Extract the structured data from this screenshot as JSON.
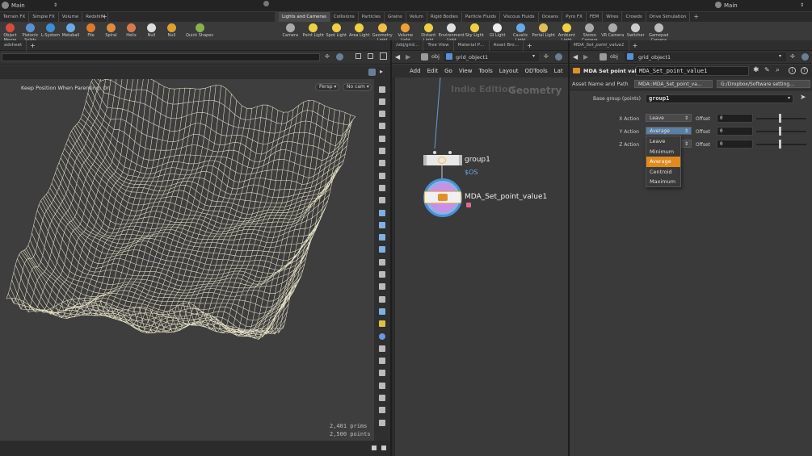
{
  "left_desktop": {
    "name": "Main"
  },
  "right_desktop": {
    "name": "Main"
  },
  "left_shelf_tabs": [
    "Terrain FX",
    "Simple FX",
    "Volume",
    "Redshift"
  ],
  "left_tools": [
    {
      "label": "Object Merge",
      "color": "#d94a3a"
    },
    {
      "label": "Platonic Solids",
      "color": "#5a8fd6"
    },
    {
      "label": "L-System",
      "color": "#3a8fd9"
    },
    {
      "label": "Metaball",
      "color": "#6aa9e9"
    },
    {
      "label": "File",
      "color": "#e07a2a"
    },
    {
      "label": "Spiral",
      "color": "#e08a3a"
    },
    {
      "label": "Helix",
      "color": "#d97a4a"
    },
    {
      "label": "Null",
      "color": "#dddddd"
    },
    {
      "label": "Null",
      "color": "#e0a030"
    },
    {
      "label": "Quick Shapes",
      "color": "#8ab04a"
    }
  ],
  "right_shelf_tabs": [
    "Lights and Cameras",
    "Collisions",
    "Particles",
    "Grains",
    "Velum",
    "Rigid Bodies",
    "Particle Fluids",
    "Viscous Fluids",
    "Oceans",
    "Pyro FX",
    "FEM",
    "Wires",
    "Crowds",
    "Drive Simulation"
  ],
  "right_tools": [
    {
      "label": "Camera",
      "color": "#aaaaaa"
    },
    {
      "label": "Point Light",
      "color": "#f0d040"
    },
    {
      "label": "Spot Light",
      "color": "#f0d040"
    },
    {
      "label": "Area Light",
      "color": "#f0d040"
    },
    {
      "label": "Geometry Light",
      "color": "#f0c040"
    },
    {
      "label": "Volume Light",
      "color": "#f0a030"
    },
    {
      "label": "Distant Light",
      "color": "#f0d040"
    },
    {
      "label": "Environment Light",
      "color": "#e0e0e0"
    },
    {
      "label": "Sky Light",
      "color": "#f0d040"
    },
    {
      "label": "GI Light",
      "color": "#eeeeee"
    },
    {
      "label": "Caustic Light",
      "color": "#6aa9e9"
    },
    {
      "label": "Portal Light",
      "color": "#e0c050"
    },
    {
      "label": "Ambient Light",
      "color": "#f0d040"
    },
    {
      "label": "Stereo Camera",
      "color": "#aaaaaa"
    },
    {
      "label": "VR Camera",
      "color": "#aaaaaa"
    },
    {
      "label": "Switcher",
      "color": "#cccccc"
    },
    {
      "label": "Gamepad Camera",
      "color": "#bbbbbb"
    }
  ],
  "viewport": {
    "pane_tab": "adsheet",
    "status": "Keep Position When Parenting: On",
    "persp": "Persp",
    "cam": "No cam",
    "prims": "2,401  prims",
    "points": "2,500  points"
  },
  "network": {
    "tabs": [
      "/obj/grid…",
      "Tree View",
      "Material P…",
      "Asset Bro…"
    ],
    "path_root": "obj",
    "path_node": "grid_object1",
    "menu": [
      "Add",
      "Edit",
      "Go",
      "View",
      "Tools",
      "Layout",
      "ODTools",
      "Lat"
    ],
    "watermark_edition": "Indie Edition",
    "watermark_context": "Geometry",
    "node1": {
      "name": "group1",
      "flag": "$OS"
    },
    "node2": {
      "name": "MDA_Set_point_value1"
    }
  },
  "params": {
    "tab": "MDA_Set_point_value1",
    "path_root": "obj",
    "path_node": "grid_object1",
    "node_type": "MDA Set point value",
    "node_name": "MDA_Set_point_value1",
    "asset_label": "Asset Name and Path",
    "asset_name": "MDA::MDA_Set_point_va…",
    "asset_path": "G:/Dropbox/Software setting…",
    "base_group_label": "Base group (points)",
    "base_group_value": "group1",
    "x_action_label": "X Action",
    "x_action_value": "Leave",
    "y_action_label": "Y Action",
    "y_action_value": "Average",
    "z_action_label": "Z Action",
    "offset_label": "Offset",
    "x_offset": "0",
    "y_offset": "0",
    "z_offset": "0",
    "dropdown_options": [
      "Leave",
      "Minimum",
      "Average",
      "Centroid",
      "Maximum"
    ],
    "selected_option": "Average"
  },
  "colors": {
    "selected": "#e08a1e",
    "node_ring": "#4a90d9",
    "flag_yellow": "#f0d040"
  }
}
